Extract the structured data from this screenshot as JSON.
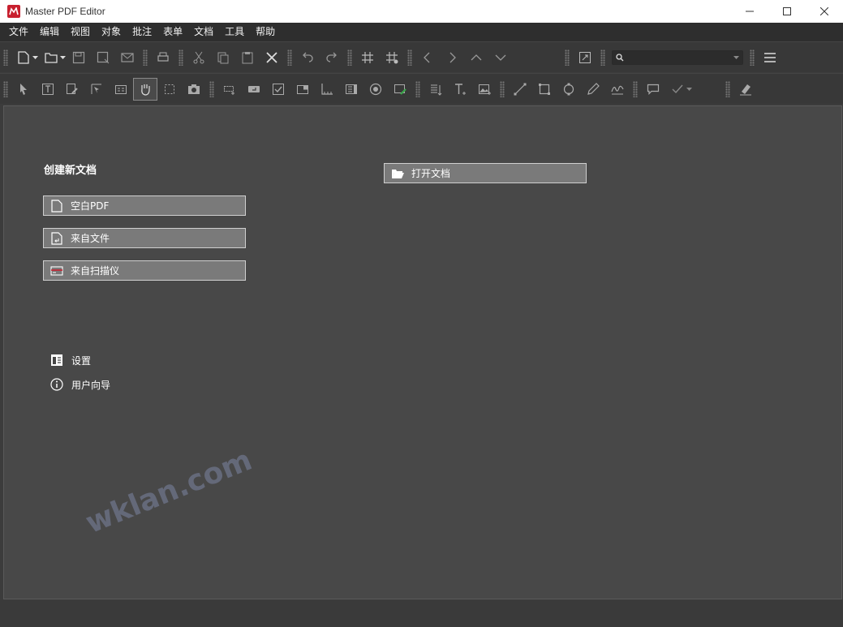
{
  "window": {
    "title": "Master PDF Editor"
  },
  "menu": {
    "items": [
      "文件",
      "编辑",
      "视图",
      "对象",
      "批注",
      "表单",
      "文档",
      "工具",
      "帮助"
    ]
  },
  "search": {
    "placeholder": "",
    "value": ""
  },
  "start": {
    "create_title": "创建新文档",
    "blank_pdf": "空白PDF",
    "from_file": "来自文件",
    "from_scanner": "来自扫描仪",
    "open_document": "打开文档",
    "settings": "设置",
    "user_guide": "用户向导"
  },
  "watermark": "wklan.com",
  "colors": {
    "brand": "#c8202f",
    "panel": "#484848",
    "button": "#7a7a7a"
  }
}
